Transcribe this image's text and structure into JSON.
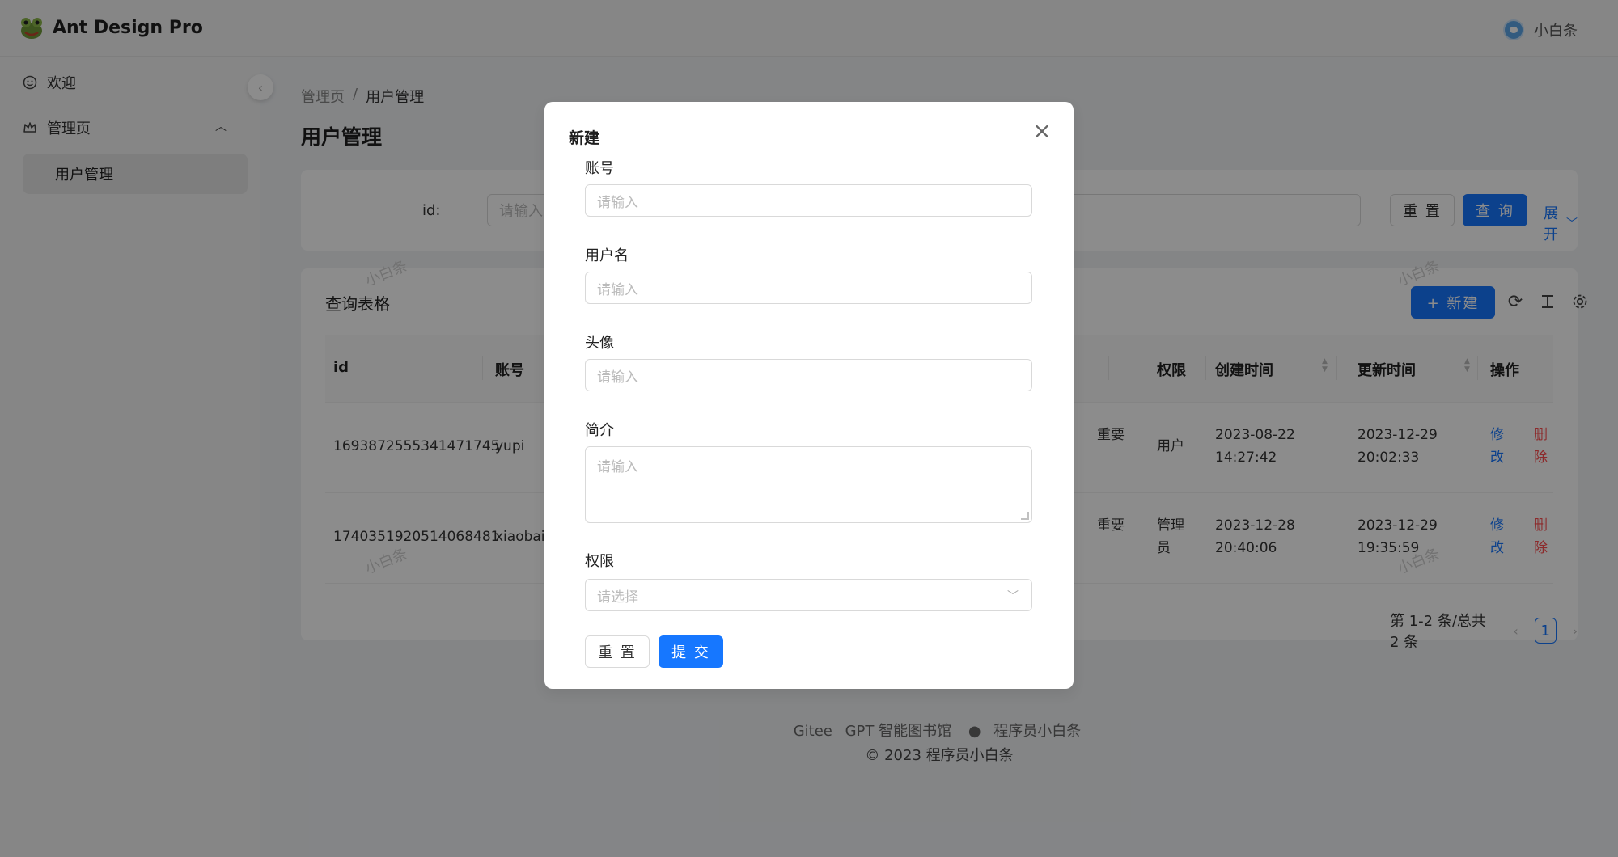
{
  "header": {
    "brand": "Ant Design Pro",
    "username": "小白条"
  },
  "sidebar": {
    "items": [
      {
        "label": "欢迎",
        "icon": "smile-icon"
      },
      {
        "label": "管理页",
        "icon": "crown-icon",
        "expanded": true
      }
    ],
    "submenu": [
      {
        "label": "用户管理",
        "active": true
      }
    ]
  },
  "breadcrumb": [
    "管理页",
    "/",
    "用户管理"
  ],
  "page_title": "用户管理",
  "search": {
    "label": "id:",
    "placeholder": "请输入",
    "reset_label": "重 置",
    "query_label": "查 询",
    "expand_label": "展开"
  },
  "table": {
    "title": "查询表格",
    "new_label": "+ 新建",
    "columns": [
      "id",
      "账号",
      "权限",
      "创建时间",
      "更新时间",
      "操作"
    ],
    "rows": [
      {
        "id": "1693872555341471745",
        "account": "yupi",
        "desc_fragment": "重要",
        "role": "用户",
        "created_date": "2023-08-22",
        "created_time": "14:27:42",
        "updated_date": "2023-12-29",
        "updated_time": "20:02:33",
        "edit_1": "修",
        "edit_2": "改",
        "del_1": "删",
        "del_2": "除"
      },
      {
        "id": "1740351920514068481",
        "account": "xiaobait",
        "desc_fragment": "重要",
        "role_1": "管理",
        "role_2": "员",
        "created_date": "2023-12-28",
        "created_time": "20:40:06",
        "updated_date": "2023-12-29",
        "updated_time": "19:35:59",
        "edit_1": "修",
        "edit_2": "改",
        "del_1": "删",
        "del_2": "除"
      }
    ],
    "pagination": {
      "summary": "第 1-2 条/总共 2 条",
      "current": "1"
    }
  },
  "footer": {
    "links": [
      "Gitee",
      "GPT 智能图书馆",
      "程序员小白条"
    ],
    "copyright": "2023 程序员小白条"
  },
  "watermark": "小白条",
  "modal": {
    "title": "新建",
    "fields": [
      {
        "label": "账号",
        "placeholder": "请输入"
      },
      {
        "label": "用户名",
        "placeholder": "请输入"
      },
      {
        "label": "头像",
        "placeholder": "请输入"
      },
      {
        "label": "简介",
        "placeholder": "请输入"
      },
      {
        "label": "权限",
        "placeholder": "请选择"
      }
    ],
    "reset_label": "重 置",
    "submit_label": "提 交"
  },
  "colors": {
    "primary": "#1677ff",
    "danger": "#ff4d4f",
    "mask": "rgba(0,0,0,0.45)"
  }
}
